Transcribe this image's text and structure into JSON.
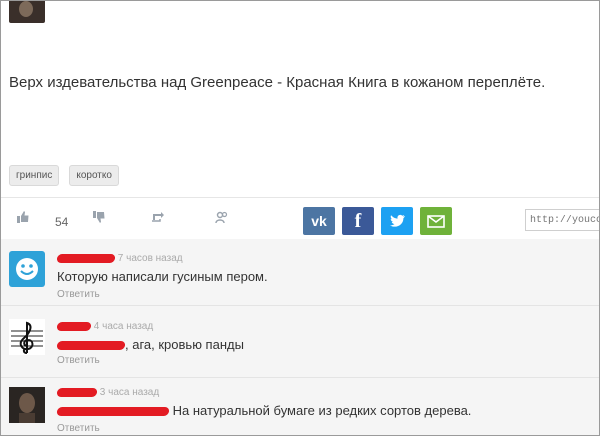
{
  "post": {
    "text": "Верх издевательства над Greenpeace - Красная Книга в кожаном переплёте.",
    "tags": [
      "гринпис",
      "коротко"
    ]
  },
  "actions": {
    "rating": "54",
    "url_placeholder": "http://youco"
  },
  "share": {
    "vk": "vk",
    "fb": "f"
  },
  "comments": [
    {
      "time": "7 часов назад",
      "text": "Которую написали гусиным пером.",
      "reply": "Ответить"
    },
    {
      "time": "4 часа назад",
      "text": ", ага, кровью панды",
      "reply": "Ответить"
    },
    {
      "time": "3 часа назад",
      "text": "На натуральной бумаге из редких сортов дерева.",
      "reply": "Ответить"
    }
  ],
  "colors": {
    "vk": "#4c75a3",
    "facebook": "#3b5998",
    "twitter": "#1da1f2",
    "email": "#6fb23a",
    "censor": "#e31b23"
  }
}
